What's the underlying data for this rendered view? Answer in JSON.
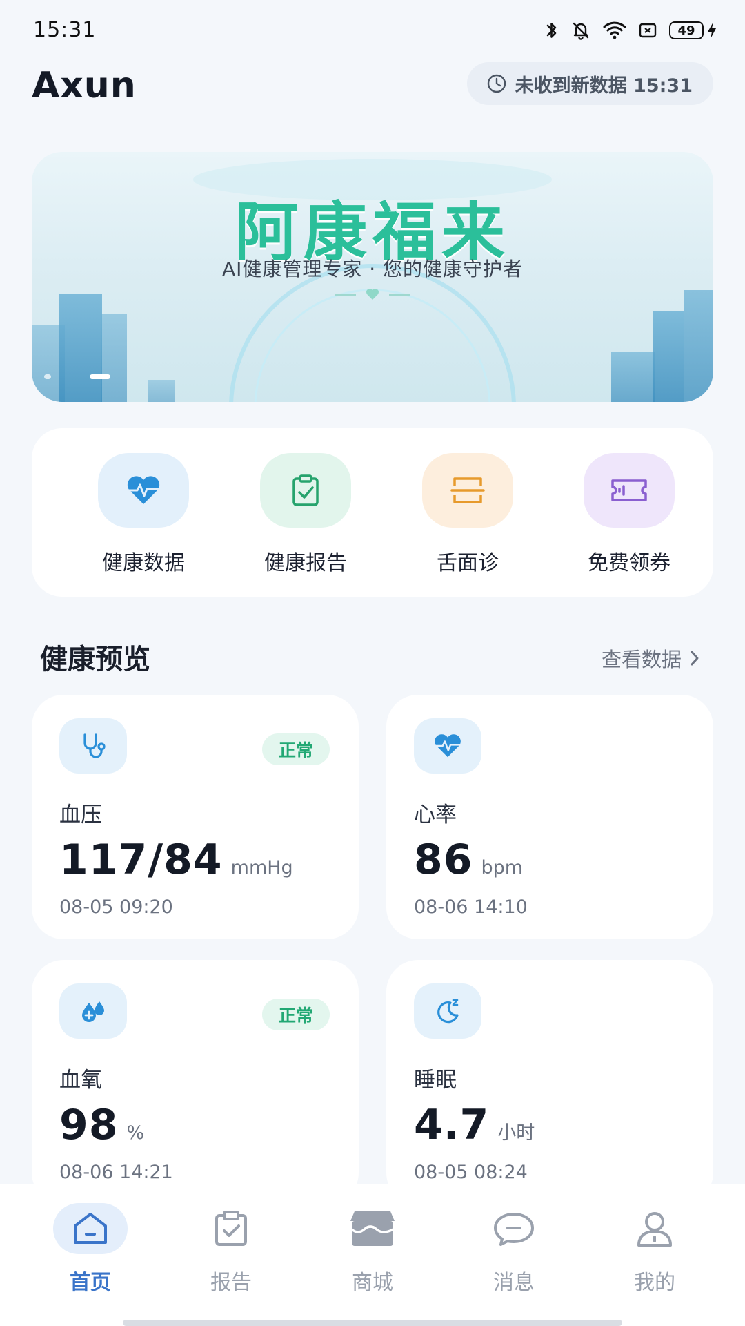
{
  "status_bar": {
    "time": "15:31",
    "battery": "49",
    "icons": [
      "bluetooth-icon",
      "bell-off-icon",
      "wifi-icon",
      "sim-icon",
      "battery-icon",
      "charging-icon"
    ]
  },
  "header": {
    "app_title": "Axun",
    "sync_status": "未收到新数据 15:31",
    "sync_icon": "clock-icon"
  },
  "banner": {
    "title": "阿康福来",
    "subtitle": "AI健康管理专家 · 您的健康守护者",
    "title_color": "#2bbf9a"
  },
  "quick_actions": [
    {
      "label": "健康数据",
      "icon": "heart-pulse-icon",
      "bg": "#e3f0fb",
      "color": "#2a8fd8"
    },
    {
      "label": "健康报告",
      "icon": "clipboard-check-icon",
      "bg": "#e2f5ec",
      "color": "#26a36d"
    },
    {
      "label": "舌面诊",
      "icon": "scan-icon",
      "bg": "#fdeedd",
      "color": "#e79a2c"
    },
    {
      "label": "免费领券",
      "icon": "ticket-icon",
      "bg": "#efe6fb",
      "color": "#8a5fd0"
    }
  ],
  "preview": {
    "title": "健康预览",
    "link": "查看数据"
  },
  "metrics": [
    {
      "name": "血压",
      "value": "117/84",
      "unit": "mmHg",
      "time": "08-05 09:20",
      "badge": "正常",
      "icon": "stethoscope-icon"
    },
    {
      "name": "心率",
      "value": "86",
      "unit": "bpm",
      "time": "08-06 14:10",
      "badge": "",
      "icon": "heart-pulse-icon"
    },
    {
      "name": "血氧",
      "value": "98",
      "unit": "%",
      "time": "08-06 14:21",
      "badge": "正常",
      "icon": "blood-drop-icon"
    },
    {
      "name": "睡眠",
      "value": "4.7",
      "unit": "小时",
      "time": "08-05 08:24",
      "badge": "",
      "icon": "moon-sleep-icon"
    }
  ],
  "bottom_nav": [
    {
      "label": "首页",
      "icon": "home-icon",
      "active": true
    },
    {
      "label": "报告",
      "icon": "report-icon",
      "active": false
    },
    {
      "label": "商城",
      "icon": "store-icon",
      "active": false
    },
    {
      "label": "消息",
      "icon": "message-icon",
      "active": false
    },
    {
      "label": "我的",
      "icon": "user-icon",
      "active": false
    }
  ],
  "colors": {
    "accent": "#3a74c9",
    "normal_badge_text": "#22a874",
    "normal_badge_bg": "#e3f6ee",
    "page_bg": "#f4f7fb"
  }
}
